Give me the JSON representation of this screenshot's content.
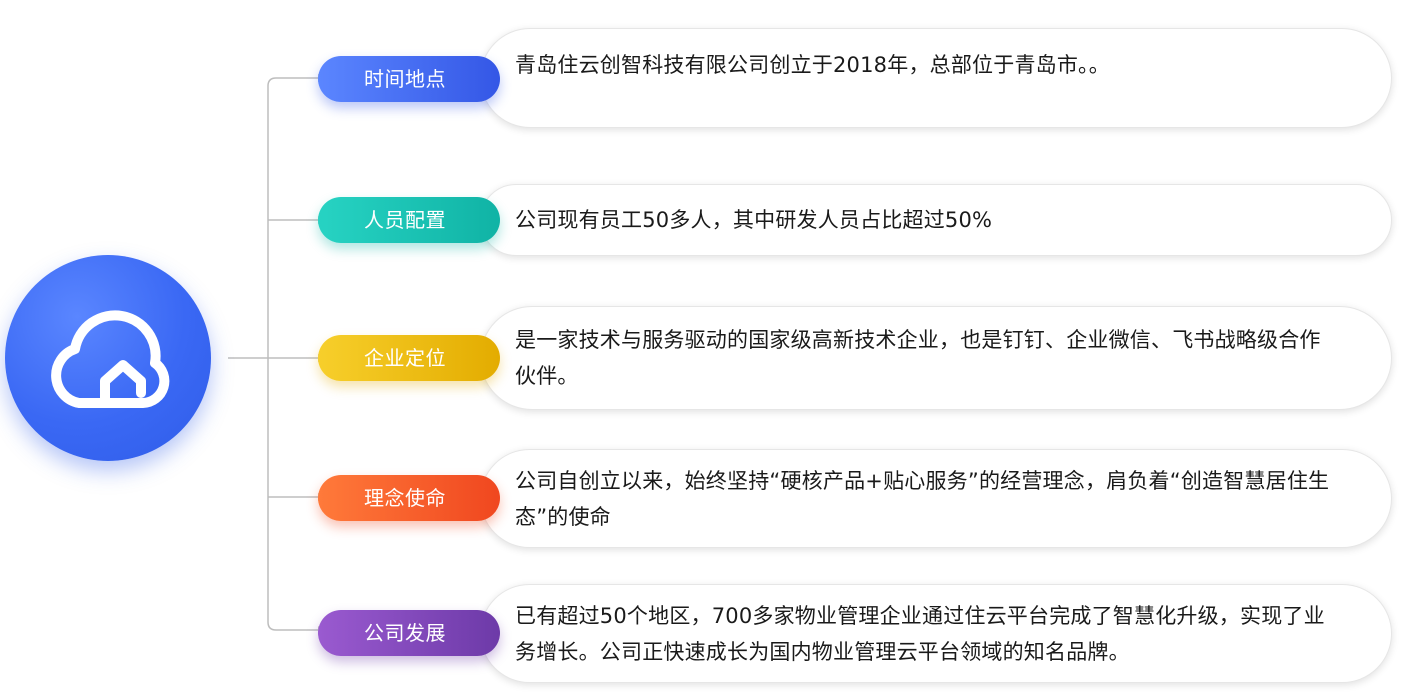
{
  "hub": {
    "icon": "cloud-house-icon",
    "color": "#3a68f4"
  },
  "rows": [
    {
      "label": "时间地点",
      "text": "青岛住云创智科技有限公司创立于2018年，总部位于青岛市。。",
      "color_start": "#5b86ff",
      "color_end": "#3457e6"
    },
    {
      "label": "人员配置",
      "text": "公司现有员工50多人，其中研发人员占比超过50%",
      "color_start": "#27d3c3",
      "color_end": "#10b3a5"
    },
    {
      "label": "企业定位",
      "text": "是一家技术与服务驱动的国家级高新技术企业，也是钉钉、企业微信、飞书战略级合作伙伴。",
      "color_start": "#f7cf2b",
      "color_end": "#e3ac00"
    },
    {
      "label": "理念使命",
      "text": "公司自创立以来，始终坚持“硬核产品+贴心服务”的经营理念，肩负着“创造智慧居住生态”的使命",
      "color_start": "#ff7a3a",
      "color_end": "#f0471f"
    },
    {
      "label": "公司发展",
      "text": "已有超过50个地区，700多家物业管理企业通过住云平台完成了智慧化升级，实现了业务增长。公司正快速成长为国内物业管理云平台领域的知名品牌。",
      "color_start": "#9a5ad0",
      "color_end": "#6d3aa8"
    }
  ],
  "connector_color": "#bdbdbd"
}
